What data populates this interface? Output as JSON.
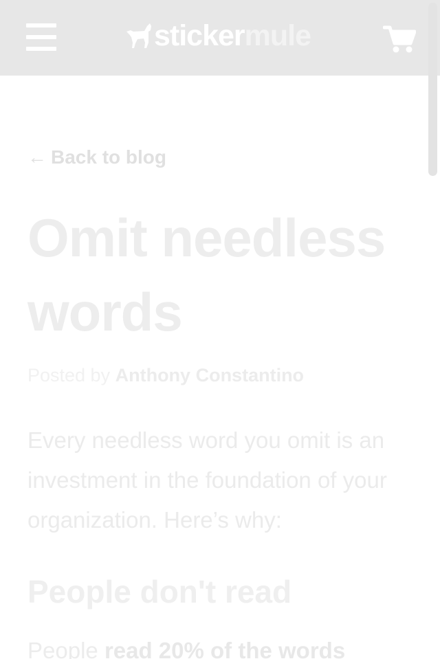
{
  "header": {
    "logo_sticker": "sticker",
    "logo_mule": "mule"
  },
  "nav": {
    "back_arrow": "←",
    "back_label": "Back to blog"
  },
  "article": {
    "title": "Omit needless words",
    "byline_prefix": "Posted by",
    "author": "Anthony Constantino",
    "intro": "Every needless word you omit is an investment in the foundation of your organization. Here’s why:",
    "section_heading": "People don't read",
    "partial_paragraph_start": "People ",
    "partial_paragraph_bold": "read 20% of the words"
  },
  "icons": {
    "menu": "hamburger-menu-icon",
    "logo": "mule-logo-icon",
    "cart": "shopping-cart-icon"
  },
  "colors": {
    "header_bg": "#e7e7e7",
    "page_bg": "#ffffff",
    "faded_text": "#ececec"
  }
}
